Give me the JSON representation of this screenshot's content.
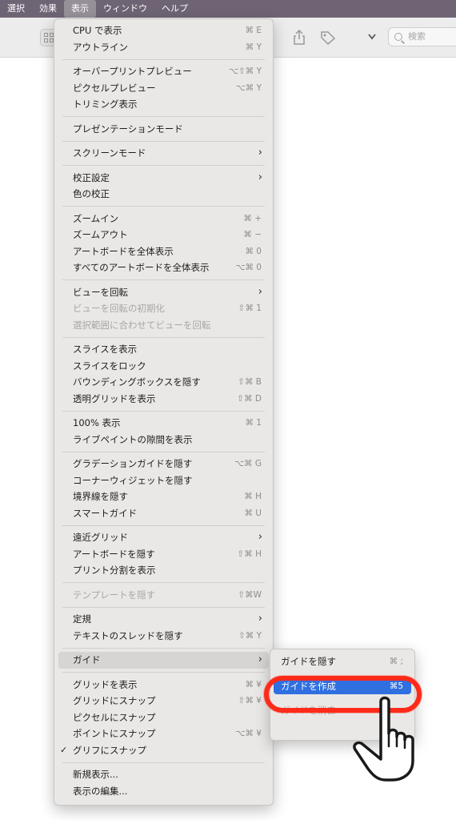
{
  "menubar": {
    "items": [
      "選択",
      "効果",
      "表示",
      "ウィンドウ",
      "ヘルプ"
    ],
    "active": "表示"
  },
  "toolbar": {
    "search_placeholder": "検索"
  },
  "menu": {
    "g1": [
      {
        "label": "CPU で表示",
        "shortcut": "⌘ E"
      },
      {
        "label": "アウトライン",
        "shortcut": "⌘ Y"
      }
    ],
    "g2": [
      {
        "label": "オーバープリントプレビュー",
        "shortcut": "⌥⇧⌘ Y"
      },
      {
        "label": "ピクセルプレビュー",
        "shortcut": "⌥⌘ Y"
      },
      {
        "label": "トリミング表示",
        "shortcut": ""
      }
    ],
    "g3": [
      {
        "label": "プレゼンテーションモード",
        "shortcut": ""
      }
    ],
    "g4": [
      {
        "label": "スクリーンモード",
        "shortcut": ""
      }
    ],
    "g5": [
      {
        "label": "校正設定",
        "shortcut": ""
      },
      {
        "label": "色の校正",
        "shortcut": ""
      }
    ],
    "g6": [
      {
        "label": "ズームイン",
        "shortcut": "⌘ +"
      },
      {
        "label": "ズームアウト",
        "shortcut": "⌘ −"
      },
      {
        "label": "アートボードを全体表示",
        "shortcut": "⌘ 0"
      },
      {
        "label": "すべてのアートボードを全体表示",
        "shortcut": "⌥⌘ 0"
      }
    ],
    "g7": [
      {
        "label": "ビューを回転",
        "shortcut": ""
      },
      {
        "label": "ビューを回転の初期化",
        "shortcut": "⇧⌘ 1"
      },
      {
        "label": "選択範囲に合わせてビューを回転",
        "shortcut": ""
      }
    ],
    "g8": [
      {
        "label": "スライスを表示",
        "shortcut": ""
      },
      {
        "label": "スライスをロック",
        "shortcut": ""
      },
      {
        "label": "バウンディングボックスを隠す",
        "shortcut": "⇧⌘ B"
      },
      {
        "label": "透明グリッドを表示",
        "shortcut": "⇧⌘ D"
      }
    ],
    "g9": [
      {
        "label": "100% 表示",
        "shortcut": "⌘ 1"
      },
      {
        "label": "ライブペイントの隙間を表示",
        "shortcut": ""
      }
    ],
    "g10": [
      {
        "label": "グラデーションガイドを隠す",
        "shortcut": "⌥⌘ G"
      },
      {
        "label": "コーナーウィジェットを隠す",
        "shortcut": ""
      },
      {
        "label": "境界線を隠す",
        "shortcut": "⌘ H"
      },
      {
        "label": "スマートガイド",
        "shortcut": "⌘ U"
      }
    ],
    "g11": [
      {
        "label": "遠近グリッド",
        "shortcut": ""
      },
      {
        "label": "アートボードを隠す",
        "shortcut": "⇧⌘ H"
      },
      {
        "label": "プリント分割を表示",
        "shortcut": ""
      }
    ],
    "g12": [
      {
        "label": "テンプレートを隠す",
        "shortcut": "⇧⌘W"
      }
    ],
    "g13": [
      {
        "label": "定規",
        "shortcut": ""
      },
      {
        "label": "テキストのスレッドを隠す",
        "shortcut": "⇧⌘ Y"
      }
    ],
    "g14": [
      {
        "label": "ガイド",
        "shortcut": ""
      }
    ],
    "g15": [
      {
        "label": "グリッドを表示",
        "shortcut": "⌘ ¥"
      },
      {
        "label": "グリッドにスナップ",
        "shortcut": "⇧⌘ ¥"
      },
      {
        "label": "ピクセルにスナップ",
        "shortcut": ""
      },
      {
        "label": "ポイントにスナップ",
        "shortcut": "⌥⌘ ¥"
      },
      {
        "label": "グリフにスナップ",
        "shortcut": ""
      }
    ],
    "g16": [
      {
        "label": "新規表示...",
        "shortcut": ""
      },
      {
        "label": "表示の編集...",
        "shortcut": ""
      }
    ]
  },
  "submenu": {
    "hide_guides": {
      "label": "ガイドを隠す",
      "shortcut": "⌘ ;"
    },
    "make_guides": {
      "label": "ガイドを作成",
      "shortcut": "⌘5"
    },
    "clear_guides": {
      "label": "ガイドを消去",
      "shortcut": ""
    }
  },
  "colors": {
    "accent": "#2f6fe0",
    "callout": "#ff2a1a",
    "menubar": "#6f6474"
  }
}
